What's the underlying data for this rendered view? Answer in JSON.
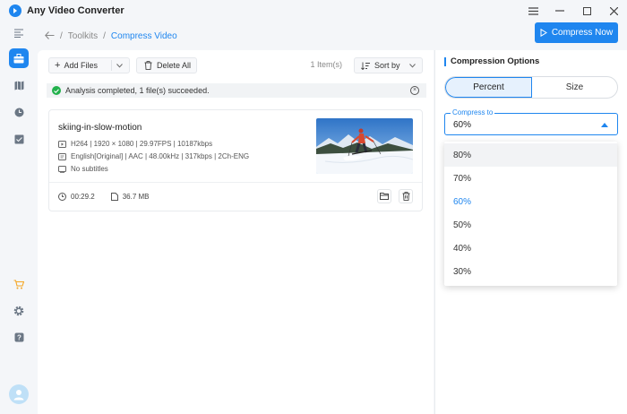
{
  "app": {
    "title": "Any Video Converter"
  },
  "breadcrumb": {
    "root": "Toolkits",
    "separator": "/",
    "current": "Compress Video"
  },
  "actions": {
    "compress_now": "Compress Now"
  },
  "toolbar": {
    "add_files": "Add Files",
    "delete_all": "Delete All",
    "item_count": "1 Item(s)",
    "sort_by": "Sort by"
  },
  "status": {
    "message": "Analysis completed, 1 file(s) succeeded."
  },
  "file": {
    "name": "skiing-in-slow-motion",
    "video_info": "H264 | 1920 × 1080 | 29.97FPS | 10187kbps",
    "audio_info": "English[Original] | AAC | 48.00kHz | 317kbps | 2Ch-ENG",
    "subtitle_info": "No subtitles",
    "duration": "00:29.2",
    "size": "36.7 MB"
  },
  "options": {
    "title": "Compression Options",
    "tabs": [
      "Percent",
      "Size"
    ],
    "active_tab": "Percent",
    "compress_label": "Compress to",
    "compress_value": "60%",
    "dropdown": [
      "80%",
      "70%",
      "60%",
      "50%",
      "40%",
      "30%"
    ],
    "dropdown_selected": "60%",
    "dropdown_hover": "80%"
  },
  "colors": {
    "accent": "#1f86ef",
    "success": "#22b14c"
  },
  "icons": {
    "sidebar": [
      "menu-icon",
      "toolbox-icon",
      "map-icon",
      "history-icon",
      "archive-icon",
      "cart-icon",
      "settings-icon",
      "help-icon"
    ]
  }
}
